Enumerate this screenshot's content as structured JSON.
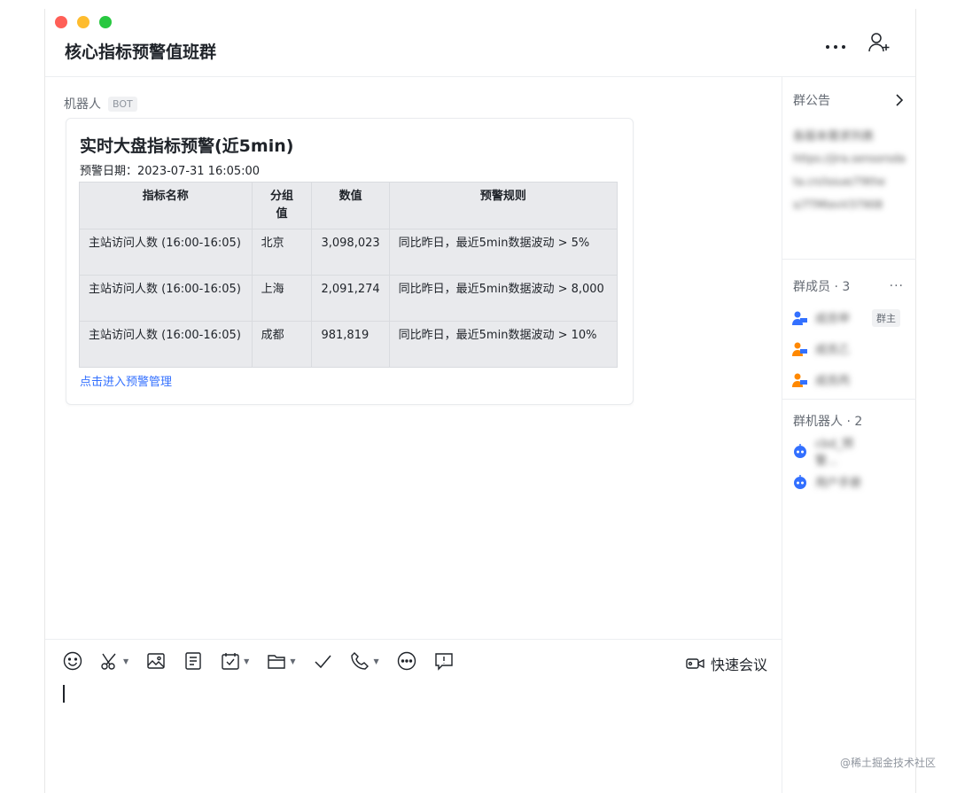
{
  "window": {
    "title": "核心指标预警值班群"
  },
  "message": {
    "sender": "机器人",
    "sender_tag": "BOT",
    "card": {
      "title": "实时大盘指标预警(近5min)",
      "date": "预警日期：2023-07-31 16:05:00",
      "columns": [
        "指标名称",
        "分组值",
        "数值",
        "预警规则"
      ],
      "rows": [
        [
          "主站访问人数 (16:00-16:05)",
          "北京",
          "3,098,023",
          "同比昨日，最近5min数据波动 > 5%"
        ],
        [
          "主站访问人数 (16:00-16:05)",
          "上海",
          "2,091,274",
          "同比昨日，最近5min数据波动 > 8,000"
        ],
        [
          "主站访问人数 (16:00-16:05)",
          "成都",
          "981,819",
          "同比昨日，最近5min数据波动 > 10%"
        ]
      ],
      "link": "点击进入预警管理"
    }
  },
  "toolbar": {
    "meeting_label": "快速会议"
  },
  "sidebar": {
    "announcement": {
      "title": "群公告",
      "text1": "各版本需求列表",
      "text2": "https://jira.sensorsdata.cn/issue/79the",
      "text3": "s/7TMtevV37908"
    },
    "members": {
      "title": "群成员 · 3",
      "items": [
        {
          "name": "成员甲",
          "tag": "群主",
          "color": "#3370ff"
        },
        {
          "name": "成员乙",
          "tag": "",
          "color": "#ff8800"
        },
        {
          "name": "成员丙",
          "tag": "",
          "color": "#ff8800"
        }
      ]
    },
    "bots": {
      "title": "群机器人 · 2",
      "items": [
        {
          "name": "cbd_预警..."
        },
        {
          "name": "用户手册"
        }
      ]
    }
  },
  "watermark": "@稀土掘金技术社区"
}
